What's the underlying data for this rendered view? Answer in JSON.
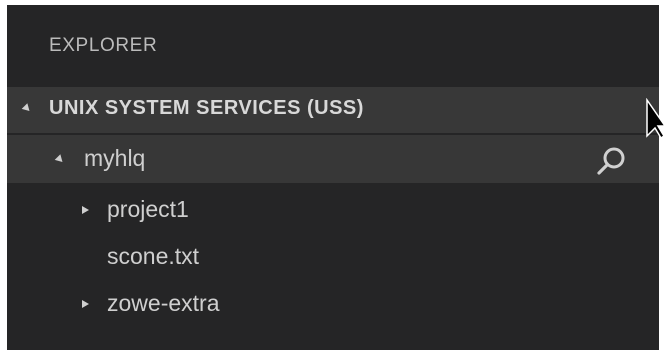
{
  "explorer": {
    "title": "EXPLORER"
  },
  "section": {
    "label": "UNIX SYSTEM SERVICES (USS)",
    "expanded": true
  },
  "tree": {
    "root": {
      "label": "myhlq",
      "expanded": true,
      "action_icon": "search-icon"
    },
    "children": [
      {
        "label": "project1",
        "type": "folder",
        "expanded": false
      },
      {
        "label": "scone.txt",
        "type": "file"
      },
      {
        "label": "zowe-extra",
        "type": "folder",
        "expanded": false
      }
    ]
  },
  "colors": {
    "panel_background": "#252526",
    "section_header_background": "#383838",
    "selected_row_background": "#373737",
    "text": "#cccccc"
  }
}
